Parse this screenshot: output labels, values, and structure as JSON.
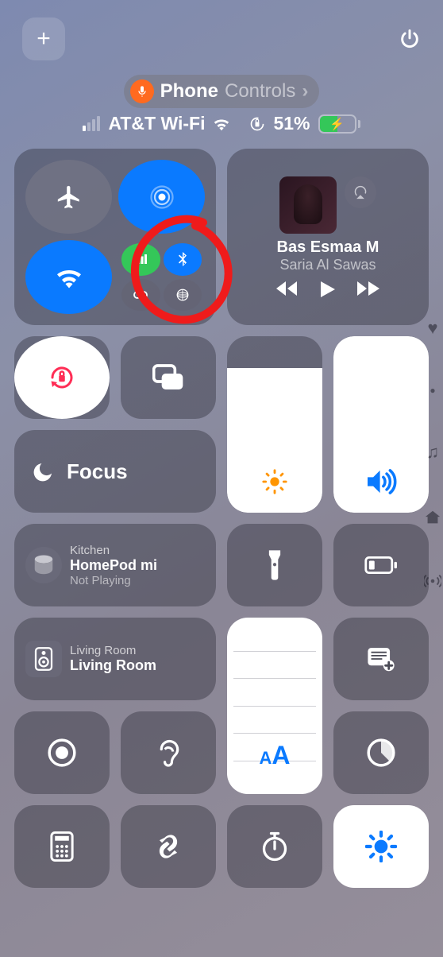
{
  "pill": {
    "label_main": "Phone",
    "label_sub": "Controls"
  },
  "status": {
    "carrier": "AT&T Wi-Fi",
    "battery_pct": "51%",
    "battery_fill": 51
  },
  "media": {
    "title": "Bas Esmaa M",
    "artist": "Saria Al Sawas"
  },
  "focus": {
    "label": "Focus"
  },
  "brightness": {
    "fill_pct": 82
  },
  "volume": {
    "fill_pct": 100
  },
  "homepod": {
    "location": "Kitchen",
    "name": "HomePod mi",
    "status": "Not Playing"
  },
  "speaker": {
    "location": "Living Room",
    "name": "Living Room"
  },
  "icons": {
    "plus": "+",
    "power": "⏻",
    "mic": "●",
    "chevron": "›",
    "airplane": "✈",
    "airdrop": "◎",
    "wifi": "wifi",
    "cellular": "▮",
    "bluetooth": "bt",
    "hotspot": "⟲",
    "satellite": "🌐",
    "airplay": "▲",
    "prev": "◀◀",
    "play": "▶",
    "next": "▶▶",
    "lock": "🔒",
    "mirroring": "▢",
    "moon": "☾",
    "sun": "☀",
    "volume_ic": "🔊",
    "flashlight": "🔦",
    "battery": "▭",
    "quicknote": "▤",
    "nearby": "⦿",
    "record": "◉",
    "hearing": "👂",
    "timer": "◔",
    "calc": "▦",
    "shazam": "∫",
    "stopwatch": "⏱",
    "sun2": "☀",
    "heart": "♥",
    "dot": "●",
    "music": "♫",
    "home": "⌂"
  }
}
